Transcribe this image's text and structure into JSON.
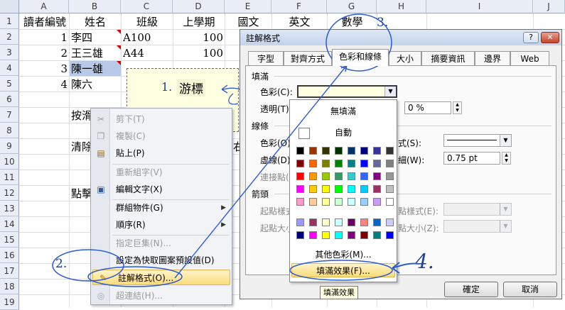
{
  "sheet": {
    "columns": [
      "A",
      "B",
      "C",
      "D",
      "E",
      "F",
      "G",
      "H",
      "I",
      "J"
    ],
    "rows": [
      "1",
      "2",
      "3",
      "4",
      "5",
      "6",
      "7",
      "8",
      "9",
      "10",
      "11",
      "12",
      "13",
      "14",
      "15",
      "16",
      "17",
      "18",
      "19"
    ],
    "headers": {
      "a1": "讀者編號",
      "b1": "姓名",
      "c1": "班級",
      "d1": "上學期",
      "e1": "國文",
      "f1": "英文",
      "g1": "數學"
    },
    "data": [
      {
        "id": "1",
        "name": "李四",
        "cls": "A100",
        "score": "100"
      },
      {
        "id": "2",
        "name": "王三雄",
        "cls": "A44",
        "score": "100"
      },
      {
        "id": "3",
        "name": "陳一雄",
        "cls": "",
        "score": ""
      },
      {
        "id": "4",
        "name": "陳六",
        "cls": "",
        "score": ""
      }
    ],
    "b7": "按滑",
    "b9": "清除",
    "b12": "點擊",
    "e9": "右"
  },
  "comment": {
    "text": "游標"
  },
  "annotations": {
    "step1": "1.",
    "step2": "2.",
    "step3": "3.",
    "step4": "4."
  },
  "context_menu": {
    "items": [
      {
        "label": "剪下(T)",
        "icon": "scissors-icon",
        "disabled": true
      },
      {
        "label": "複製(C)",
        "icon": "copy-icon",
        "disabled": true
      },
      {
        "label": "貼上(P)",
        "icon": "paste-icon",
        "disabled": false
      },
      {
        "label": "重新組字(V)",
        "icon": "",
        "disabled": true
      },
      {
        "label": "編輯文字(X)",
        "icon": "edit-text-icon",
        "disabled": false
      },
      {
        "label": "群組物件(G)",
        "icon": "",
        "disabled": false,
        "submenu": true
      },
      {
        "label": "順序(R)",
        "icon": "",
        "disabled": false,
        "submenu": true
      },
      {
        "label": "指定巨集(N)...",
        "icon": "",
        "disabled": true
      },
      {
        "label": "設定為快取圖案預設值(D)",
        "icon": "",
        "disabled": false
      },
      {
        "label": "註解格式(O)...",
        "icon": "format-comment-icon",
        "disabled": false,
        "highlighted": true
      },
      {
        "label": "超連結(H)...",
        "icon": "hyperlink-icon",
        "disabled": true
      }
    ]
  },
  "dialog": {
    "title": "註解格式",
    "help_label": "?",
    "close_label": "✕",
    "tabs": [
      "字型",
      "對齊方式",
      "色彩和線條",
      "大小",
      "摘要資訊",
      "邊界",
      "Web"
    ],
    "active_tab": "色彩和線條",
    "fill_group": "填滿",
    "fill_color_label": "色彩(C):",
    "transparency_label": "透明(T):",
    "transparency_value": "0 %",
    "line_group": "線條",
    "line_color_label": "色彩(O):",
    "dash_label": "虛線(D):",
    "connector_label": "連接點(",
    "style_label": "式(S):",
    "weight_label": "細(W):",
    "weight_value": "0.75 pt",
    "arrow_group": "箭頭",
    "begin_style_label": "起點樣式",
    "begin_size_label": "起點大小",
    "end_style_label": "點樣式(E):",
    "end_size_label": "點大小(Z):",
    "ok_label": "確定",
    "cancel_label": "取消"
  },
  "color_popup": {
    "no_fill": "無填滿",
    "automatic": "自動",
    "more_colors": "其他色彩(M)...",
    "fill_effects": "填滿效果(F)...",
    "palette": [
      [
        "#000000",
        "#993300",
        "#333300",
        "#003300",
        "#003366",
        "#000080",
        "#333399",
        "#333333"
      ],
      [
        "#800000",
        "#ff6600",
        "#808000",
        "#008000",
        "#008080",
        "#0000ff",
        "#666699",
        "#808080"
      ],
      [
        "#ff0000",
        "#ff9900",
        "#99cc00",
        "#339966",
        "#33cccc",
        "#3366ff",
        "#800080",
        "#969696"
      ],
      [
        "#ff00ff",
        "#ffcc00",
        "#ffff00",
        "#00ff00",
        "#00ffff",
        "#00ccff",
        "#993366",
        "#c0c0c0"
      ],
      [
        "#ff99cc",
        "#ffcc99",
        "#ffff99",
        "#ccffcc",
        "#ccffff",
        "#99ccff",
        "#cc99ff",
        "#ffffff"
      ]
    ],
    "extra_palette": [
      [
        "#9999ff",
        "#993366",
        "#ffffcc",
        "#ccffff",
        "#660066",
        "#ff8080",
        "#0066cc",
        "#ccccff"
      ],
      [
        "#000080",
        "#ff00ff",
        "#ffff00",
        "#00ffff",
        "#800080",
        "#800000",
        "#008080",
        "#0000ff"
      ]
    ]
  },
  "tooltip": {
    "text": "填滿效果"
  },
  "colors": {
    "annotation": "#1a3f9c",
    "highlight": "#fbdc7a",
    "comment_bg": "#ffffe1"
  }
}
